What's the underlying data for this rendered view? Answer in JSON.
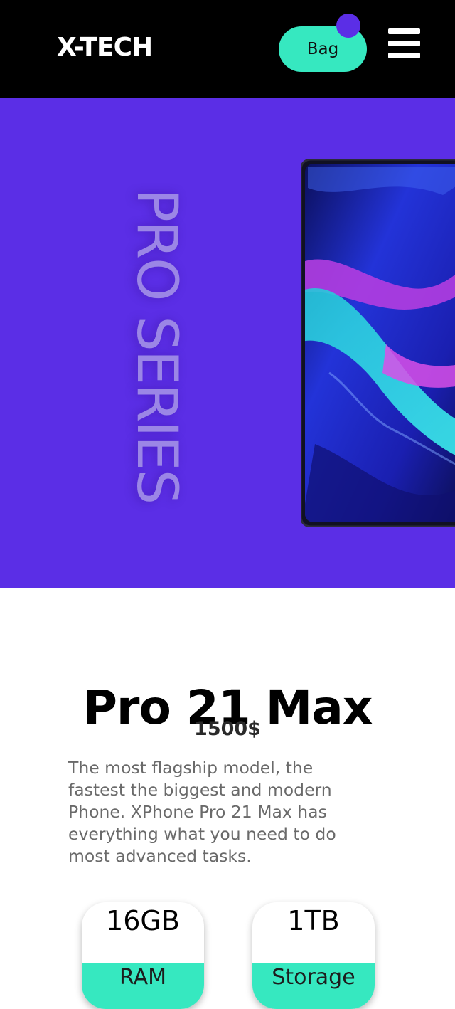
{
  "colors": {
    "header_bg": "#000000",
    "accent_mint": "#36e8c0",
    "accent_purple": "#5b2ee6",
    "hero_text": "#9b86e6"
  },
  "header": {
    "logo": "X-TECH",
    "bag_label": "Bag",
    "menu_icon": "hamburger-menu-icon"
  },
  "hero": {
    "series_text": "PRO SERIES"
  },
  "product": {
    "title": "Pro 21 Max",
    "price": "1500$",
    "description": "The most flagship model, the fastest the biggest and modern Phone. XPhone Pro 21 Max has everything what you need to do most advanced tasks."
  },
  "specs": [
    {
      "value": "16GB",
      "label": "RAM"
    },
    {
      "value": "1TB",
      "label": "Storage"
    }
  ]
}
